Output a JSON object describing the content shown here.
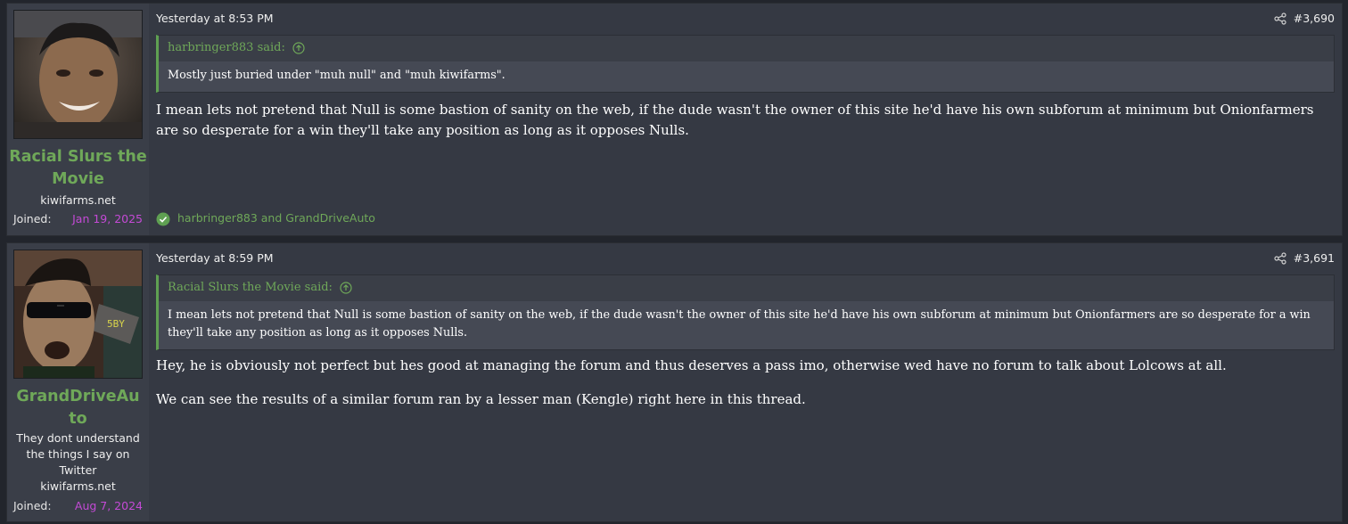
{
  "posts": [
    {
      "username": "Racial Slurs the Movie",
      "user_title": "kiwifarms.net",
      "joined_label": "Joined:",
      "joined_date": "Jan 19, 2025",
      "time": "Yesterday at 8:53 PM",
      "post_number": "#3,690",
      "quote": {
        "author_label": "harbringer883 said:",
        "text": "Mostly just buried under \"muh null\" and \"muh kiwifarms\"."
      },
      "message": [
        "I mean lets not pretend that Null is some bastion of sanity on the web, if the dude wasn't the owner of this site he'd have his own subforum at minimum but Onionfarmers are so desperate for a win they'll take any position as long as it opposes Nulls."
      ],
      "reactions": "harbringer883 and GrandDriveAuto"
    },
    {
      "username": "GrandDriveAuto",
      "user_title": "They dont understand the things I say on Twitter",
      "user_subtitle": "kiwifarms.net",
      "joined_label": "Joined:",
      "joined_date": "Aug 7, 2024",
      "time": "Yesterday at 8:59 PM",
      "post_number": "#3,691",
      "quote": {
        "author_label": "Racial Slurs the Movie said:",
        "text": "I mean lets not pretend that Null is some bastion of sanity on the web, if the dude wasn't the owner of this site he'd have his own subforum at minimum but Onionfarmers are so desperate for a win they'll take any position as long as it opposes Nulls."
      },
      "message": [
        "Hey, he is obviously not perfect but hes good at managing the forum and thus deserves a pass imo, otherwise wed have no forum to talk about Lolcows at all.",
        "We can see the results of a similar forum ran by a lesser man (Kengle) right here in this thread."
      ]
    }
  ],
  "icons": {
    "share": "share-icon",
    "quote_jump": "arrow-up-circle-icon",
    "reaction": "check-circle-icon"
  },
  "colors": {
    "username": "#6fa859",
    "joined_date": "#c44ad6",
    "quote_border": "#5fa052"
  }
}
